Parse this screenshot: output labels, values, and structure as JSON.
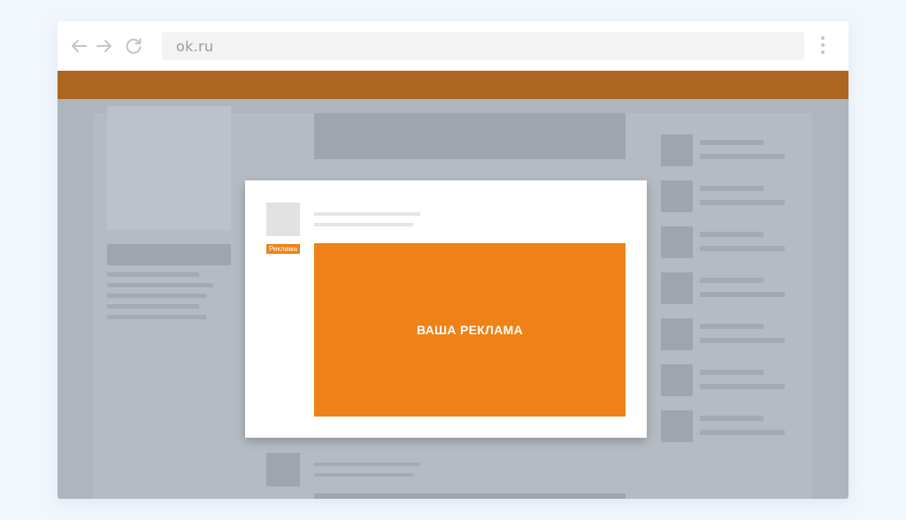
{
  "browser": {
    "url": "ok.ru",
    "icons": {
      "back": "arrow-left-icon",
      "forward": "arrow-right-icon",
      "reload": "reload-icon",
      "menu": "vertical-dots-icon"
    }
  },
  "colors": {
    "brand_bar": "#ad6620",
    "ad_accent": "#ef8116"
  },
  "ad_post": {
    "badge_label": "Реклама",
    "banner_text": "ВАША РЕКЛАМА"
  }
}
